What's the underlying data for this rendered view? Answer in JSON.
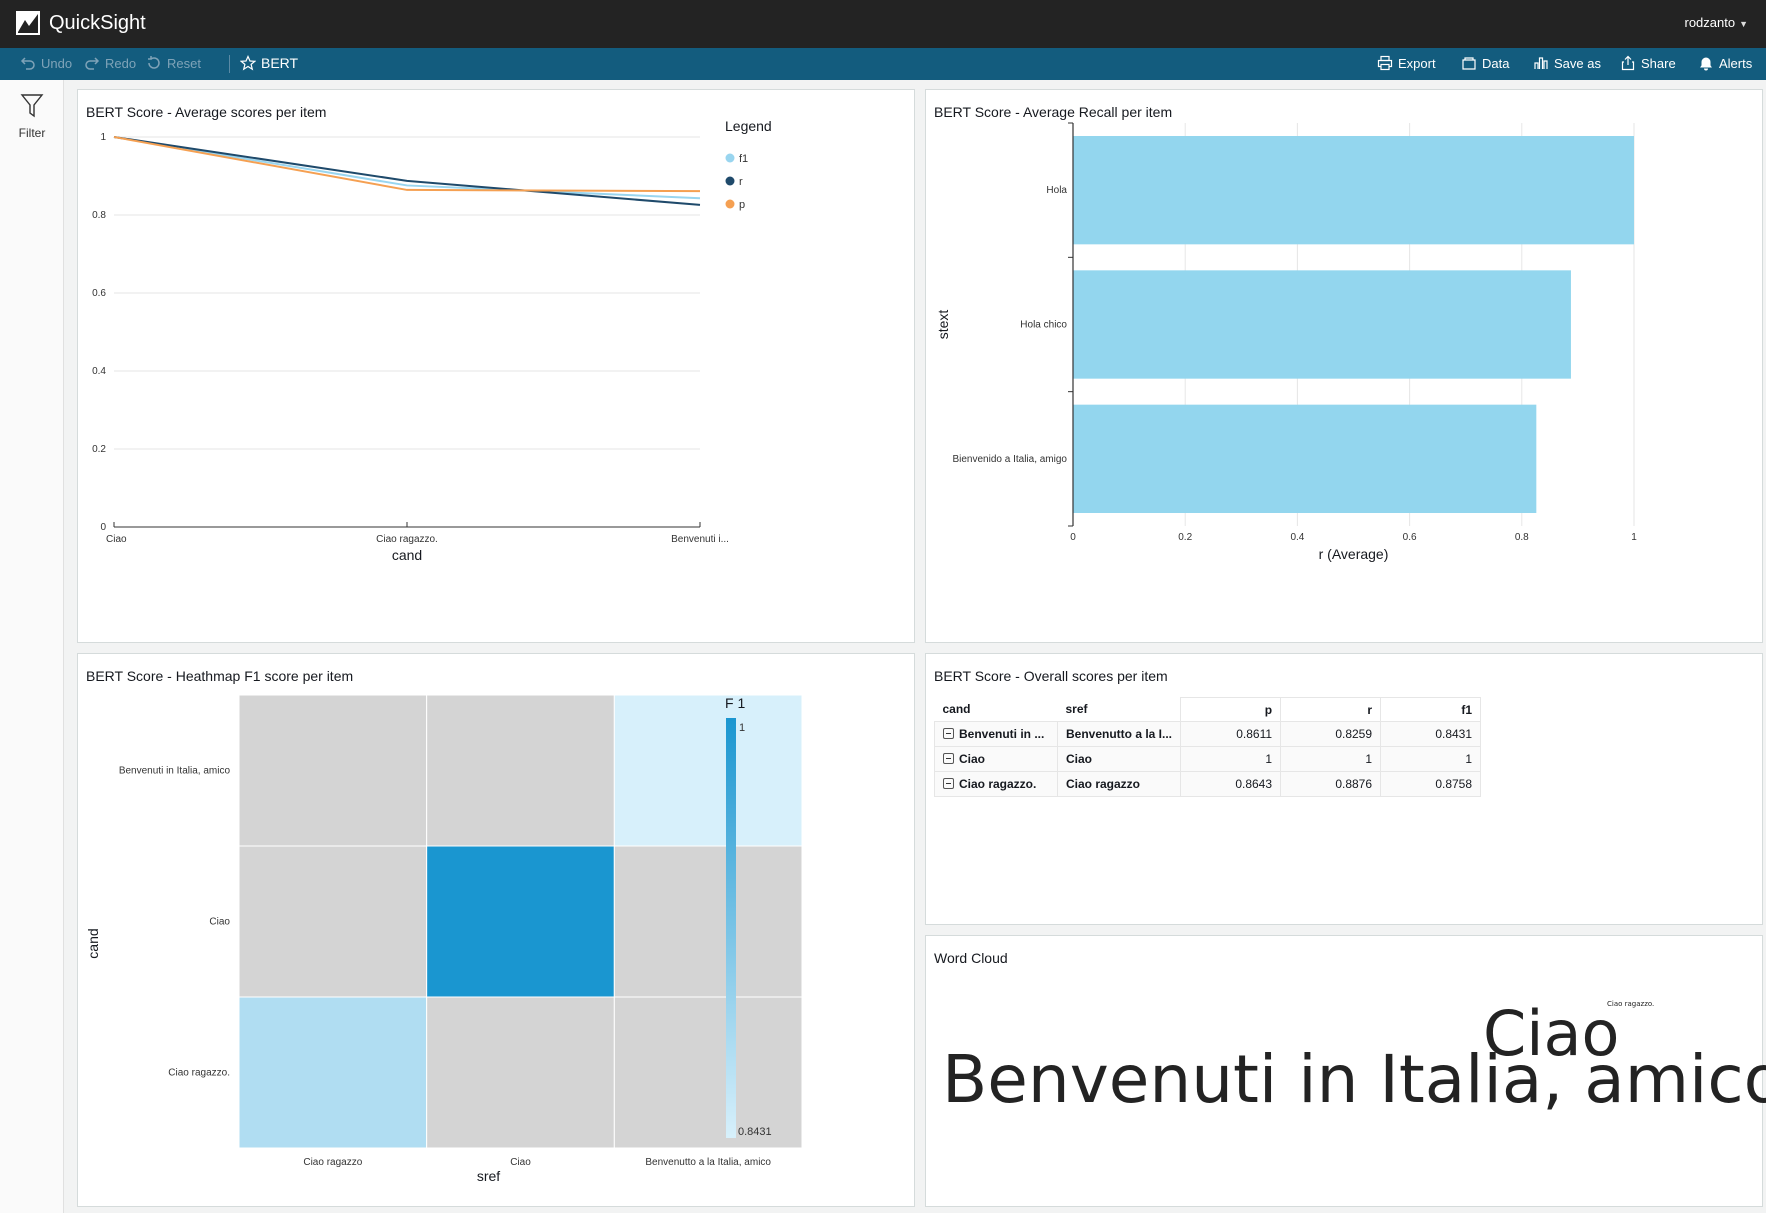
{
  "app": {
    "name": "QuickSight",
    "user": "rodzanto"
  },
  "toolbar": {
    "undo": "Undo",
    "redo": "Redo",
    "reset": "Reset",
    "title": "BERT",
    "export": "Export",
    "data": "Data",
    "save_as": "Save as",
    "share": "Share",
    "alerts": "Alerts"
  },
  "filter": {
    "label": "Filter"
  },
  "line_panel": {
    "title": "BERT Score - Average scores per item"
  },
  "recall_panel": {
    "title": "BERT Score - Average Recall per item"
  },
  "heatmap_panel": {
    "title": "BERT Score - Heathmap F1 score per item"
  },
  "table_panel": {
    "title": "BERT Score - Overall scores per item",
    "columns": [
      "cand",
      "sref",
      "p",
      "r",
      "f1"
    ],
    "rows": [
      {
        "cand": "Benvenuti in ...",
        "sref": "Benvenutto a la I...",
        "p": "0.8611",
        "r": "0.8259",
        "f1": "0.8431"
      },
      {
        "cand": "Ciao",
        "sref": "Ciao",
        "p": "1",
        "r": "1",
        "f1": "1"
      },
      {
        "cand": "Ciao ragazzo.",
        "sref": "Ciao ragazzo",
        "p": "0.8643",
        "r": "0.8876",
        "f1": "0.8758"
      }
    ]
  },
  "wordcloud_panel": {
    "title": "Word Cloud",
    "words": [
      "Benvenuti in Italia, amico",
      "Ciao",
      "Ciao ragazzo."
    ]
  },
  "colors": {
    "f1": "#99d5ef",
    "r": "#1f4a6b",
    "p": "#f5a052",
    "bar": "#93d6ee",
    "heat_high": "#1a96d0",
    "heat_low": "#d7f0fb",
    "heat_null": "#d4d4d4"
  },
  "chart_data": [
    {
      "type": "line",
      "categories": [
        "Ciao",
        "Ciao ragazzo.",
        "Benvenuti i..."
      ],
      "series": [
        {
          "name": "f1",
          "values": [
            1,
            0.8758,
            0.8431
          ]
        },
        {
          "name": "r",
          "values": [
            1,
            0.8876,
            0.8259
          ]
        },
        {
          "name": "p",
          "values": [
            1,
            0.8643,
            0.8611
          ]
        }
      ],
      "xlabel": "cand",
      "ylabel": "",
      "ylim": [
        0,
        1
      ],
      "yticks": [
        "0",
        "0.2",
        "0.4",
        "0.6",
        "0.8",
        "1"
      ],
      "legend_title": "Legend",
      "legend_position": "right",
      "grid": true
    },
    {
      "type": "bar",
      "orientation": "horizontal",
      "categories": [
        "Hola",
        "Hola chico",
        "Bienvenido a Italia, amigo"
      ],
      "values": [
        1,
        0.8876,
        0.8259
      ],
      "xlabel": "r (Average)",
      "ylabel": "stext",
      "xlim": [
        0,
        1
      ],
      "xticks": [
        "0",
        "0.2",
        "0.4",
        "0.6",
        "0.8",
        "1"
      ],
      "grid": true
    },
    {
      "type": "heatmap",
      "x": [
        "Ciao ragazzo",
        "Ciao",
        "Benvenutto a la Italia, amico"
      ],
      "y": [
        "Benvenuti in Italia, amico",
        "Ciao",
        "Ciao ragazzo."
      ],
      "values": [
        [
          null,
          null,
          0.8431
        ],
        [
          null,
          1,
          null
        ],
        [
          0.8758,
          null,
          null
        ]
      ],
      "xlabel": "sref",
      "ylabel": "cand",
      "legend_title": "F 1",
      "range_labels": [
        "1",
        "0.8431"
      ],
      "range": [
        0.8431,
        1
      ]
    }
  ]
}
